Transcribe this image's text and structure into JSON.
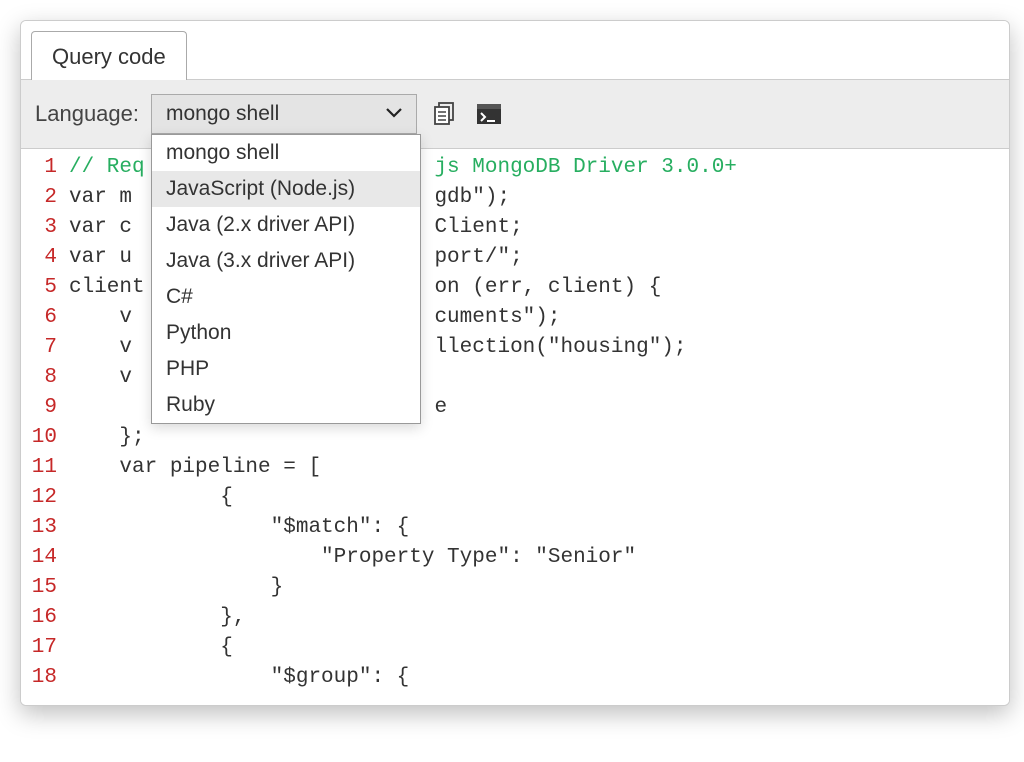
{
  "tab": {
    "label": "Query code"
  },
  "toolbar": {
    "language_label": "Language:",
    "selected": "mongo shell",
    "options": [
      "mongo shell",
      "JavaScript (Node.js)",
      "Java (2.x driver API)",
      "Java (3.x driver API)",
      "C#",
      "Python",
      "PHP",
      "Ruby"
    ],
    "hovered_index": 1
  },
  "code": {
    "line_numbers": [
      "1",
      "2",
      "3",
      "4",
      "5",
      "6",
      "7",
      "8",
      "9",
      "10",
      "11",
      "12",
      "13",
      "14",
      "15",
      "16",
      "17",
      "18"
    ],
    "lines": [
      {
        "type": "comment",
        "text": "// Req                       js MongoDB Driver 3.0.0+"
      },
      {
        "type": "plain",
        "text": "var m                        gdb\");"
      },
      {
        "type": "plain",
        "text": "var c                        Client;"
      },
      {
        "type": "plain",
        "text": "var u                        port/\";"
      },
      {
        "type": "plain",
        "text": "client                       on (err, client) {"
      },
      {
        "type": "plain",
        "text": "    v                        cuments\");"
      },
      {
        "type": "plain",
        "text": "    v                        llection(\"housing\");"
      },
      {
        "type": "plain",
        "text": "    v"
      },
      {
        "type": "plain",
        "text": "                             e"
      },
      {
        "type": "plain",
        "text": "    };"
      },
      {
        "type": "plain",
        "text": "    var pipeline = ["
      },
      {
        "type": "plain",
        "text": "            {"
      },
      {
        "type": "plain",
        "text": "                \"$match\": {"
      },
      {
        "type": "plain",
        "text": "                    \"Property Type\": \"Senior\""
      },
      {
        "type": "plain",
        "text": "                }"
      },
      {
        "type": "plain",
        "text": "            },"
      },
      {
        "type": "plain",
        "text": "            {"
      },
      {
        "type": "plain",
        "text": "                \"$group\": {"
      }
    ]
  }
}
